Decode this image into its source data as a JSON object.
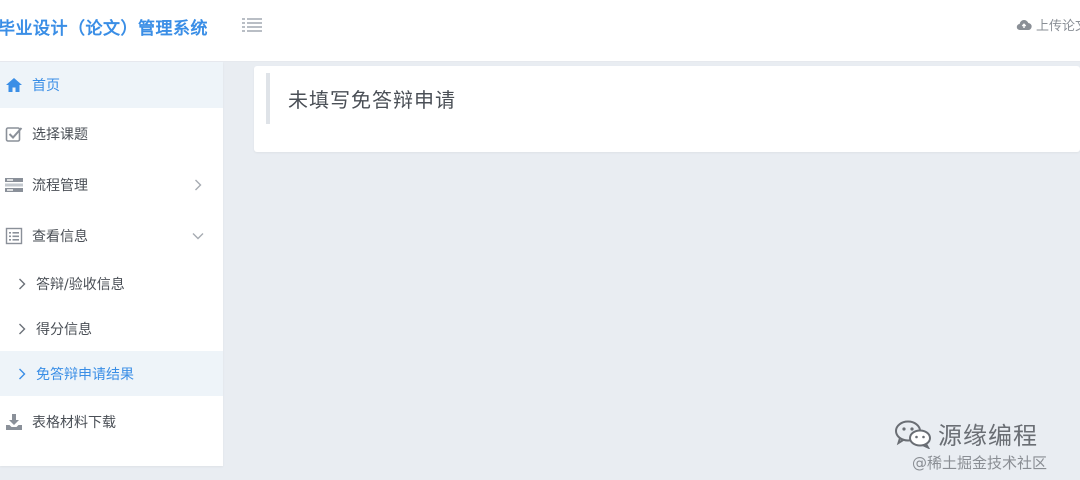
{
  "header": {
    "app_title": "毕业设计（论文）管理系统",
    "upload_label": "上传论文"
  },
  "sidebar": {
    "items": [
      {
        "label": "首页",
        "icon": "home-icon"
      },
      {
        "label": "选择课题",
        "icon": "checkbox-icon"
      },
      {
        "label": "流程管理",
        "icon": "process-icon"
      },
      {
        "label": "查看信息",
        "icon": "info-list-icon"
      },
      {
        "label": "表格材料下载",
        "icon": "download-icon"
      }
    ],
    "subitems": [
      {
        "label": "答辩/验收信息"
      },
      {
        "label": "得分信息"
      },
      {
        "label": "免答辩申请结果"
      }
    ]
  },
  "main": {
    "notice": "未填写免答辩申请"
  },
  "watermark": {
    "brand": "源缘编程",
    "credit": "@稀土掘金技术社区"
  },
  "colors": {
    "accent": "#3a8ee6",
    "text": "#4a4f56",
    "muted": "#8a8f96",
    "background": "#e9edf2",
    "active_bg": "#eef4f9"
  }
}
